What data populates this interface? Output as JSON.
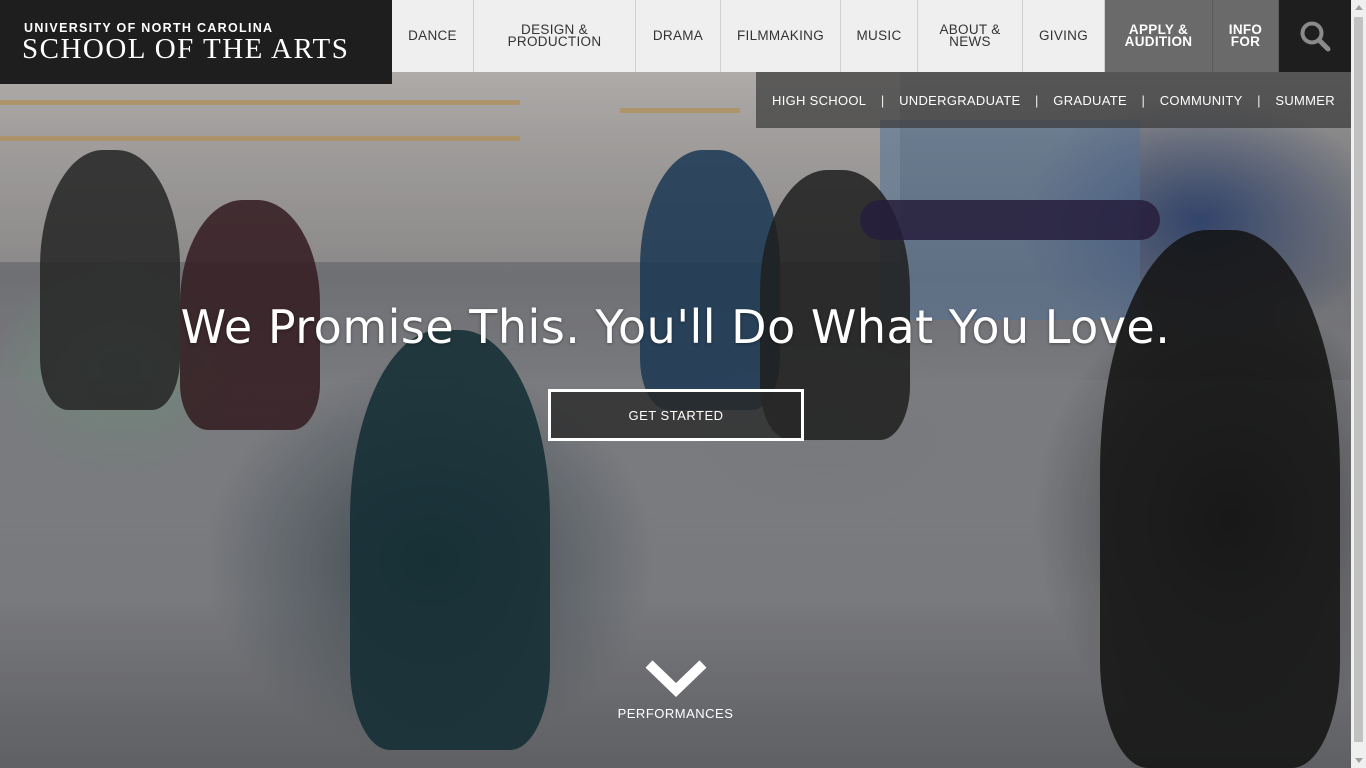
{
  "logo": {
    "line1": "UNIVERSITY OF NORTH CAROLINA",
    "line2": "SCHOOL OF THE ARTS"
  },
  "nav": {
    "items": [
      {
        "label": "DANCE"
      },
      {
        "label": "DESIGN & PRODUCTION"
      },
      {
        "label": "DRAMA"
      },
      {
        "label": "FILMMAKING"
      },
      {
        "label": "MUSIC"
      },
      {
        "label": "ABOUT & NEWS"
      },
      {
        "label": "GIVING"
      },
      {
        "label": "APPLY & AUDITION"
      },
      {
        "label": "INFO FOR"
      }
    ],
    "search_icon": "search-icon"
  },
  "subnav": {
    "items": [
      "HIGH SCHOOL",
      "UNDERGRADUATE",
      "GRADUATE",
      "COMMUNITY",
      "SUMMER"
    ]
  },
  "hero": {
    "headline": "We Promise This. You'll Do What You Love.",
    "cta": "GET STARTED",
    "scroll_label": "PERFORMANCES",
    "scroll_icon": "chevron-down-icon"
  },
  "colors": {
    "header_dark": "#1e1e1e",
    "nav_light": "#efefef",
    "nav_accent": "#6a6a6a"
  }
}
